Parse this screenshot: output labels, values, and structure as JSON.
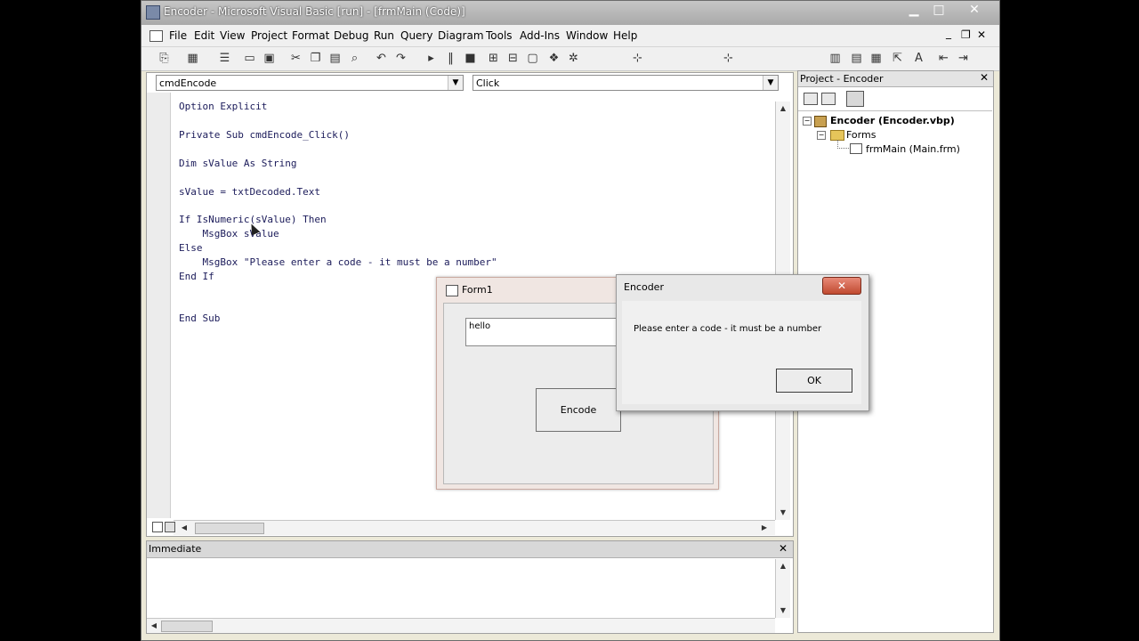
{
  "window": {
    "title": "Encoder - Microsoft Visual Basic [run] - [frmMain (Code)]",
    "minimize": "▁",
    "maximize": "□",
    "close": "✕"
  },
  "menu": [
    "File",
    "Edit",
    "View",
    "Project",
    "Format",
    "Debug",
    "Run",
    "Query",
    "Diagram",
    "Tools",
    "Add-Ins",
    "Window",
    "Help"
  ],
  "mdi_controls": {
    "minimize": "_",
    "restore": "❐",
    "close": "✕"
  },
  "code_window": {
    "object_combo": "cmdEncode",
    "procedure_combo": "Click",
    "lines": [
      "Option Explicit",
      "",
      "Private Sub cmdEncode_Click()",
      "",
      "Dim sValue As String",
      "",
      "sValue = txtDecoded.Text",
      "",
      "If IsNumeric(sValue) Then",
      "    MsgBox sValue",
      "Else",
      "    MsgBox \"Please enter a code - it must be a number\"",
      "End If",
      "",
      "",
      "End Sub"
    ]
  },
  "immediate": {
    "title": "Immediate",
    "close": "✕"
  },
  "project": {
    "title": "Project - Encoder",
    "close": "✕",
    "tree": {
      "root": "Encoder (Encoder.vbp)",
      "folder": "Forms",
      "item": "frmMain (Main.frm)"
    }
  },
  "form1": {
    "title": "Form1",
    "textbox_value": "hello",
    "button_label": "Encode"
  },
  "msgbox": {
    "title": "Encoder",
    "close": "✕",
    "message": "Please enter a code - it must be a number",
    "ok_label": "OK"
  }
}
